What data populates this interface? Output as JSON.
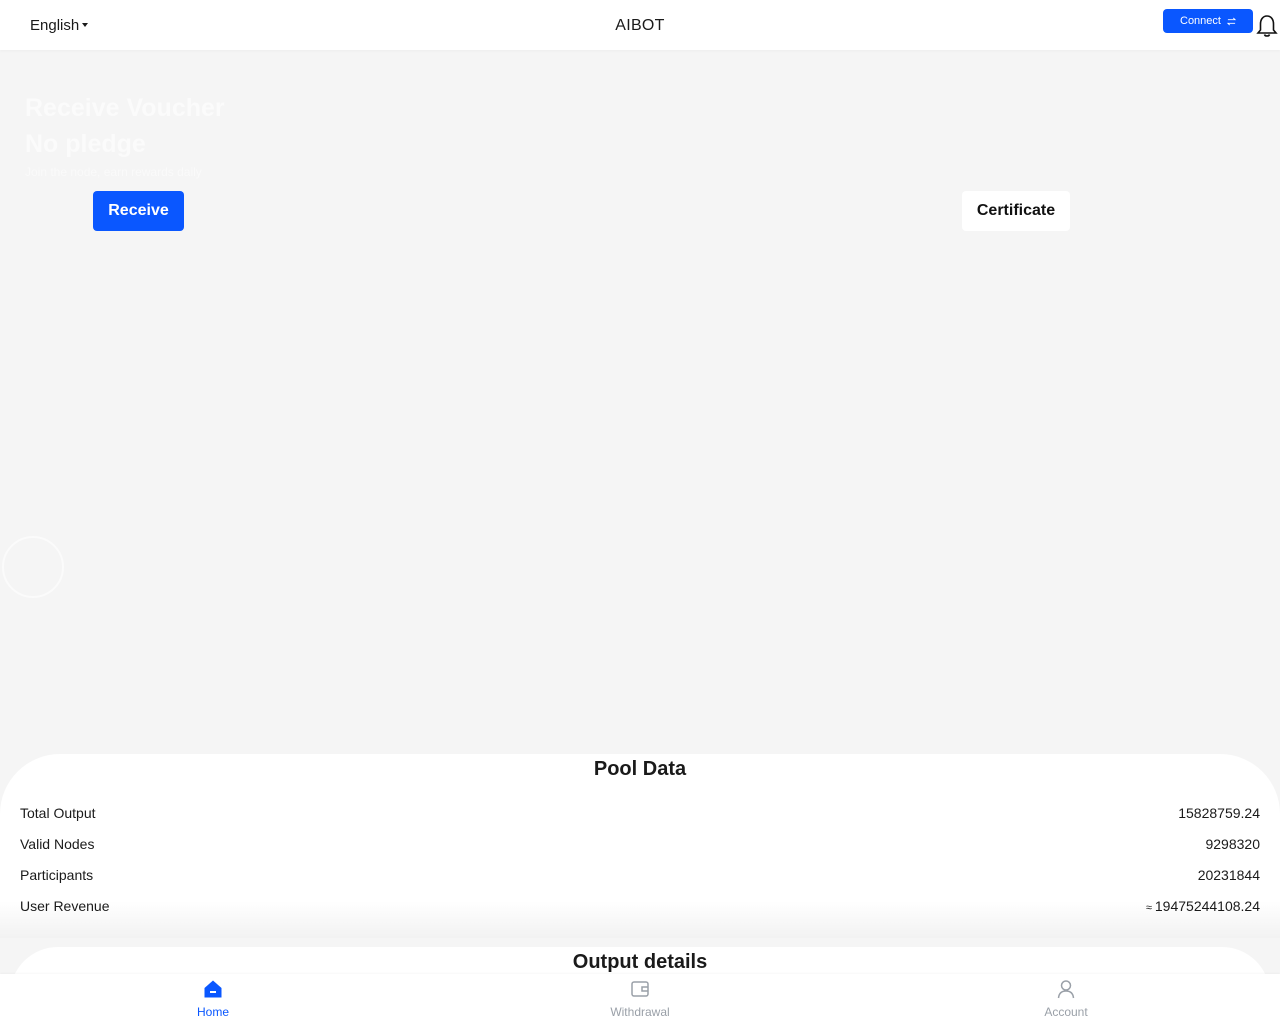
{
  "header": {
    "language": "English",
    "brand": "AIBOT",
    "connect_label": "Connect"
  },
  "hero": {
    "title": "Receive Voucher",
    "subtitle": "No pledge",
    "note": "Join the node, earn rewards daily",
    "receive_label": "Receive",
    "certificate_label": "Certificate"
  },
  "pool": {
    "title": "Pool Data",
    "rows": [
      {
        "label": "Total Output",
        "value": "15828759.24"
      },
      {
        "label": "Valid Nodes",
        "value": "9298320"
      },
      {
        "label": "Participants",
        "value": "20231844"
      },
      {
        "label": "User Revenue",
        "approx": "≈",
        "value": "19475244108.24"
      }
    ]
  },
  "output": {
    "title": "Output details"
  },
  "nav": {
    "items": [
      {
        "label": "Home",
        "icon": "home-icon",
        "active": true
      },
      {
        "label": "Withdrawal",
        "icon": "wallet-icon",
        "active": false
      },
      {
        "label": "Account",
        "icon": "user-icon",
        "active": false
      }
    ]
  },
  "colors": {
    "accent": "#0a57ff",
    "background": "#f5f5f5",
    "inactive": "#9aa0a8"
  }
}
